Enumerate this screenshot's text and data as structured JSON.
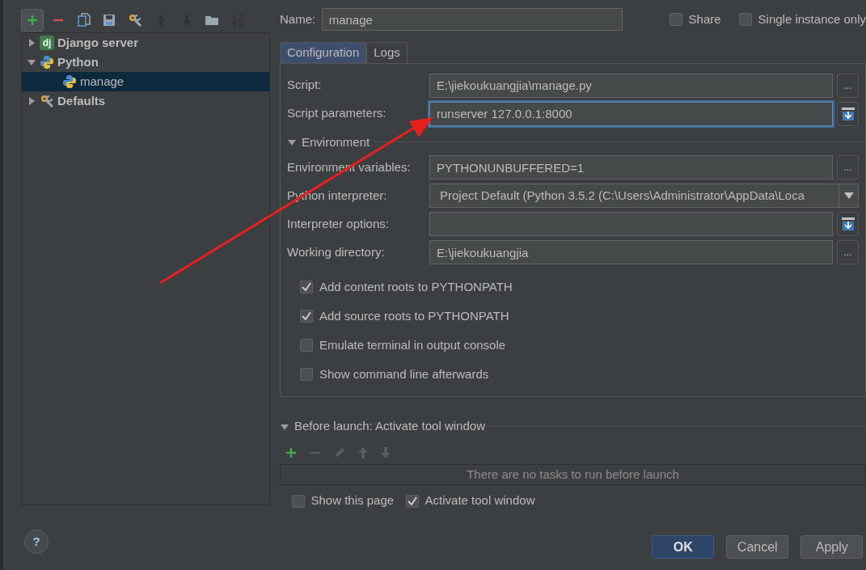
{
  "toolbar": [
    {
      "kind": "add",
      "disabled": false,
      "highlighted": true
    },
    {
      "kind": "remove",
      "disabled": false,
      "highlighted": false
    },
    {
      "kind": "copy",
      "disabled": false,
      "highlighted": false
    },
    {
      "kind": "save",
      "disabled": false,
      "highlighted": false
    },
    {
      "kind": "wrench",
      "disabled": false,
      "highlighted": false
    },
    {
      "kind": "up",
      "disabled": true,
      "highlighted": false
    },
    {
      "kind": "down",
      "disabled": true,
      "highlighted": false
    },
    {
      "kind": "folder",
      "disabled": false,
      "highlighted": false
    },
    {
      "kind": "sort",
      "disabled": true,
      "highlighted": false
    }
  ],
  "tree": [
    {
      "label": "Django server",
      "kind": "django",
      "badge": "dj",
      "expanded": false,
      "selected": false
    },
    {
      "label": "Python",
      "kind": "python",
      "expanded": true,
      "selected": false,
      "children": [
        {
          "label": "manage",
          "kind": "python",
          "selected": true
        }
      ]
    },
    {
      "label": "Defaults",
      "kind": "wrench",
      "expanded": false,
      "selected": false
    }
  ],
  "help_button": "?",
  "name_field": {
    "label": "Name:",
    "value": "manage"
  },
  "header_options": [
    {
      "label": "Share",
      "checked": false
    },
    {
      "label": "Single instance only",
      "checked": false
    }
  ],
  "tabs": [
    {
      "label": "Configuration",
      "selected": true
    },
    {
      "label": "Logs",
      "selected": false
    }
  ],
  "fields": [
    {
      "label": "Script:",
      "value": "E:\\jiekoukuangjia\\manage.py",
      "kind": "browse",
      "button_label": "...",
      "focused": false
    },
    {
      "label": "Script parameters:",
      "value": "runserver 127.0.0.1:8000",
      "kind": "expand",
      "focused": true
    }
  ],
  "environment": {
    "title": "Environment",
    "expanded": true,
    "fields": [
      {
        "label": "Environment variables:",
        "value": "PYTHONUNBUFFERED=1",
        "kind": "browse",
        "button_label": "...",
        "focused": false
      },
      {
        "label": "Python interpreter:",
        "value": "Project Default (Python 3.5.2 (C:\\Users\\Administrator\\AppData\\Loca",
        "kind": "dropdown",
        "focused": false
      },
      {
        "label": "Interpreter options:",
        "kind": "expand",
        "focused": false
      },
      {
        "label": "Working directory:",
        "value": "E:\\jiekoukuangjia",
        "kind": "browse",
        "button_label": "...",
        "focused": false
      }
    ]
  },
  "options": [
    {
      "label": "Add content roots to PYTHONPATH",
      "checked": true
    },
    {
      "label": "Add source roots to PYTHONPATH",
      "checked": true
    },
    {
      "label": "Emulate terminal in output console",
      "checked": false
    },
    {
      "label": "Show command line afterwards",
      "checked": false
    }
  ],
  "before_launch": {
    "title": "Before launch: Activate tool window",
    "expanded": true,
    "toolbar": [
      {
        "kind": "add",
        "disabled": false
      },
      {
        "kind": "remove",
        "disabled": true
      },
      {
        "kind": "edit",
        "disabled": true
      },
      {
        "kind": "up",
        "disabled": true
      },
      {
        "kind": "down",
        "disabled": true
      }
    ],
    "empty_text": "There are no tasks to run before launch",
    "options": [
      {
        "label": "Show this page",
        "checked": false
      },
      {
        "label": "Activate tool window",
        "checked": true
      }
    ]
  },
  "buttons": [
    {
      "label": "OK",
      "primary": true
    },
    {
      "label": "Cancel",
      "primary": false
    },
    {
      "label": "Apply",
      "primary": false
    }
  ]
}
